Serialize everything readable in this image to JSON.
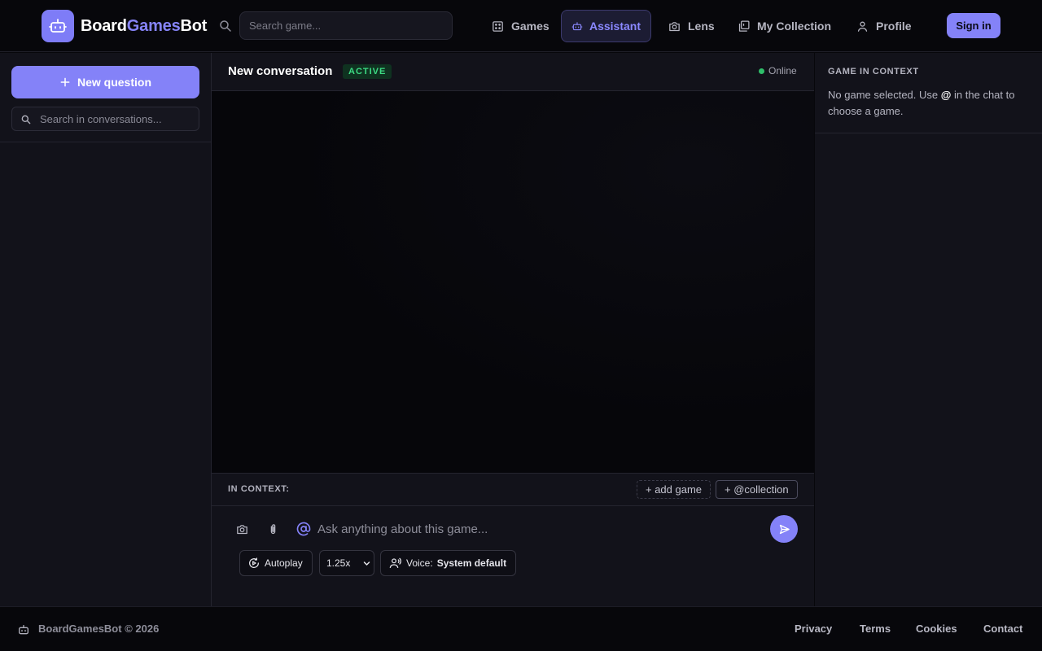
{
  "app": {
    "brand_part1": "Board",
    "brand_part2": "Games",
    "brand_part3": "Bot",
    "accent_color": "#8482f8"
  },
  "topnav": {
    "search_placeholder": "Search game...",
    "items": [
      {
        "label": "Games",
        "icon": "dice-icon",
        "active": false
      },
      {
        "label": "Assistant",
        "icon": "robot-icon",
        "active": true
      },
      {
        "label": "Lens",
        "icon": "camera-icon",
        "active": false
      },
      {
        "label": "My Collection",
        "icon": "collection-icon",
        "active": false
      },
      {
        "label": "Profile",
        "icon": "user-icon",
        "active": false
      }
    ],
    "signin_label": "Sign in"
  },
  "sidebar": {
    "new_question_label": "New question",
    "search_placeholder": "Search in conversations..."
  },
  "chat": {
    "title": "New conversation",
    "status_badge": "ACTIVE",
    "online_label": "Online",
    "context_label": "IN CONTEXT:",
    "add_game_label": "+ add game",
    "collection_label": "+ @collection",
    "input_placeholder": "Ask anything about this game...",
    "autoplay_label": "Autoplay",
    "speed_value": "1.25x",
    "speed_options": [
      "1.25x"
    ],
    "voice_label": "Voice:",
    "voice_value": "System default"
  },
  "right_panel": {
    "title": "GAME IN CONTEXT",
    "text_before": "No game selected. Use ",
    "text_at": "@",
    "text_after": " in the chat to choose a game."
  },
  "footer": {
    "copyright": "BoardGamesBot © 2026",
    "links": [
      "Privacy",
      "Terms",
      "Cookies",
      "Contact"
    ]
  }
}
